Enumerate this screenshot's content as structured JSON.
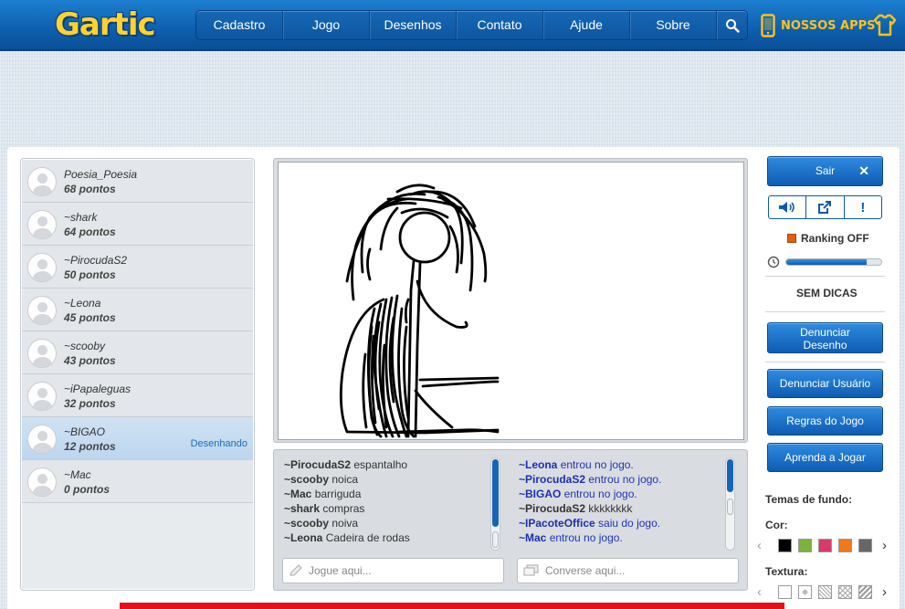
{
  "header": {
    "logo": "Gartic",
    "nav": [
      "Cadastro",
      "Jogo",
      "Desenhos",
      "Contato",
      "Ajude",
      "Sobre"
    ],
    "apps_label": "NOSSOS APPS"
  },
  "players": [
    {
      "name": "Poesia_Poesia",
      "score": "68 pontos",
      "status": ""
    },
    {
      "name": "~shark",
      "score": "64 pontos",
      "status": ""
    },
    {
      "name": "~PirocudaS2",
      "score": "50 pontos",
      "status": ""
    },
    {
      "name": "~Leona",
      "score": "45 pontos",
      "status": ""
    },
    {
      "name": "~scooby",
      "score": "43 pontos",
      "status": ""
    },
    {
      "name": "~iPapaleguas",
      "score": "32 pontos",
      "status": ""
    },
    {
      "name": "~BIGAO",
      "score": "12 pontos",
      "status": "Desenhando"
    },
    {
      "name": "~Mac",
      "score": "0 pontos",
      "status": ""
    }
  ],
  "answers": [
    {
      "user": "~PirocudaS2",
      "text": " espantalho"
    },
    {
      "user": "~scooby",
      "text": " noica"
    },
    {
      "user": "~Mac",
      "text": " barriguda"
    },
    {
      "user": "~shark",
      "text": " compras"
    },
    {
      "user": "~scooby",
      "text": " noiva"
    },
    {
      "user": "~Leona",
      "text": " Cadeira de rodas"
    }
  ],
  "messages": [
    {
      "user": "~Leona",
      "text": " entrou no jogo.",
      "system": true
    },
    {
      "user": "~PirocudaS2",
      "text": " entrou no jogo.",
      "system": true
    },
    {
      "user": "~BIGAO",
      "text": " entrou no jogo.",
      "system": true
    },
    {
      "user": "~PirocudaS2",
      "text": " kkkkkkkk",
      "system": false
    },
    {
      "user": "~IPacoteOffice",
      "text": " saiu do jogo.",
      "system": true
    },
    {
      "user": "~Mac",
      "text": " entrou no jogo.",
      "system": true
    }
  ],
  "inputs": {
    "answer_placeholder": "Jogue aqui...",
    "chat_placeholder": "Converse aqui..."
  },
  "sidebar": {
    "exit_label": "Sair",
    "ranking": "Ranking OFF",
    "timer_fraction": 0.85,
    "hints": "SEM DICAS",
    "report_drawing": "Denunciar Desenho",
    "report_user": "Denunciar Usuário",
    "rules": "Regras do Jogo",
    "learn": "Aprenda a Jogar",
    "themes_title": "Temas de fundo:",
    "color_label": "Cor:",
    "texture_label": "Textura:"
  },
  "colors": {
    "accent": "#0d5cb2",
    "swatches": [
      "#000000",
      "#7ab43a",
      "#d83a6a",
      "#f0781e",
      "#666666"
    ],
    "ranking_dot": "#e06010"
  }
}
